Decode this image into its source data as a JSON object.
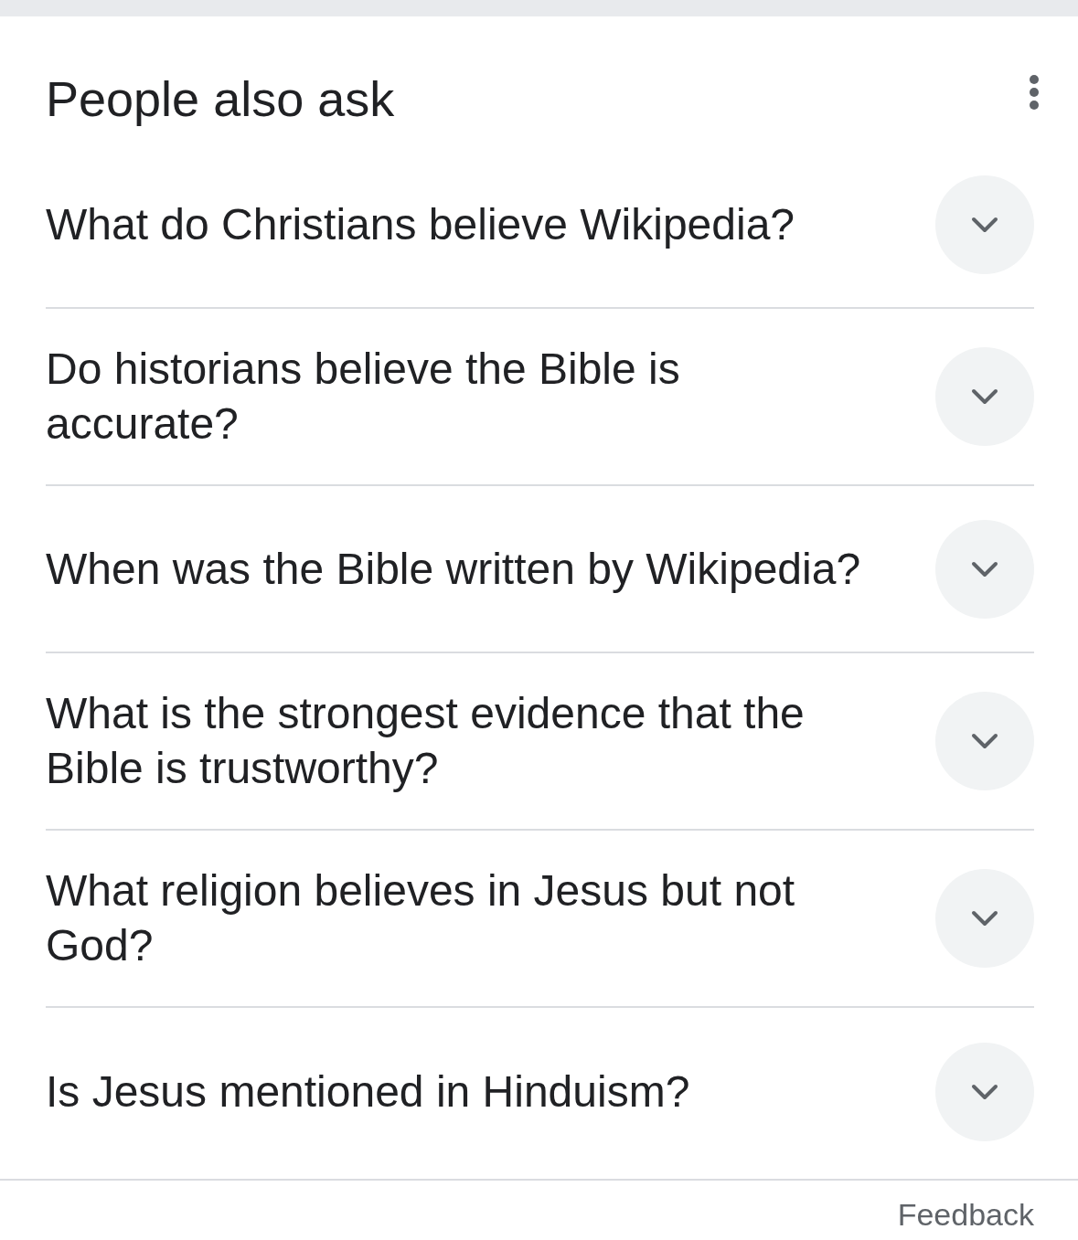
{
  "title": "People also ask",
  "questions": [
    {
      "text": "What do Christians believe Wikipedia?",
      "expanded": false
    },
    {
      "text": "Do historians believe the Bible is accurate?",
      "expanded": false
    },
    {
      "text": "When was the Bible written by Wikipedia?",
      "expanded": false
    },
    {
      "text": "What is the strongest evidence that the Bible is trustworthy?",
      "expanded": false
    },
    {
      "text": "What religion believes in Jesus but not God?",
      "expanded": false
    },
    {
      "text": "Is Jesus mentioned in Hinduism?",
      "expanded": false
    }
  ],
  "footer": {
    "link": "Feedback"
  }
}
